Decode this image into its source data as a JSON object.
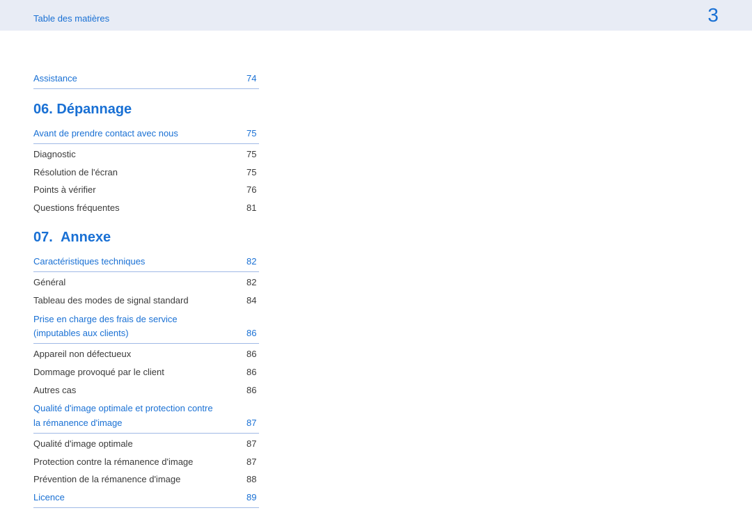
{
  "header": {
    "title": "Table des matières",
    "page_number": "3"
  },
  "top_entry": {
    "label": "Assistance",
    "page": "74"
  },
  "sections": [
    {
      "number": "06.",
      "title": "Dépannage",
      "entries": [
        {
          "label": "Avant de prendre contact avec nous",
          "page": "75",
          "link": true
        },
        {
          "label": "Diagnostic",
          "page": "75",
          "link": false
        },
        {
          "label": "Résolution de l'écran",
          "page": "75",
          "link": false
        },
        {
          "label": "Points à vérifier",
          "page": "76",
          "link": false
        },
        {
          "label": "Questions fréquentes",
          "page": "81",
          "link": false
        }
      ]
    },
    {
      "number": "07.",
      "title": "Annexe",
      "entries": [
        {
          "label": "Caractéristiques techniques",
          "page": "82",
          "link": true
        },
        {
          "label": "Général",
          "page": "82",
          "link": false
        },
        {
          "label": "Tableau des modes de signal standard",
          "page": "84",
          "link": false
        },
        {
          "label": "Prise en charge des frais de service (imputables aux clients)",
          "page": "86",
          "link": true
        },
        {
          "label": "Appareil non défectueux",
          "page": "86",
          "link": false
        },
        {
          "label": "Dommage provoqué par le client",
          "page": "86",
          "link": false
        },
        {
          "label": "Autres cas",
          "page": "86",
          "link": false
        },
        {
          "label": "Qualité d'image optimale et protection contre la rémanence d'image",
          "page": "87",
          "link": true
        },
        {
          "label": "Qualité d'image optimale",
          "page": "87",
          "link": false
        },
        {
          "label": "Protection contre la rémanence d'image",
          "page": "87",
          "link": false
        },
        {
          "label": "Prévention de la rémanence d'image",
          "page": "88",
          "link": false
        },
        {
          "label": "Licence",
          "page": "89",
          "link": true
        }
      ]
    }
  ]
}
